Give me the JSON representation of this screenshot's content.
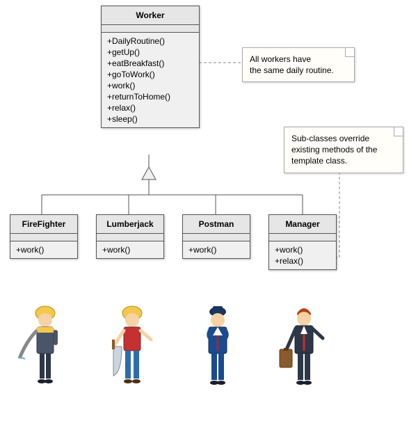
{
  "diagram": {
    "parent_class": {
      "name": "Worker",
      "methods": [
        "+DailyRoutine()",
        "+getUp()",
        "+eatBreakfast()",
        "+goToWork()",
        "+work()",
        "+returnToHome()",
        "+relax()",
        "+sleep()"
      ]
    },
    "subclasses": [
      {
        "name": "FireFighter",
        "methods": [
          "+work()"
        ]
      },
      {
        "name": "Lumberjack",
        "methods": [
          "+work()"
        ]
      },
      {
        "name": "Postman",
        "methods": [
          "+work()"
        ]
      },
      {
        "name": "Manager",
        "methods": [
          "+work()",
          "+relax()"
        ]
      }
    ],
    "notes": {
      "note1": "All workers have\nthe same daily routine.",
      "note2": "Sub-classes override\nexisting methods of the\ntemplate class."
    },
    "illustrations": [
      "firefighter-illustration",
      "lumberjack-illustration",
      "postman-illustration",
      "manager-illustration"
    ]
  }
}
